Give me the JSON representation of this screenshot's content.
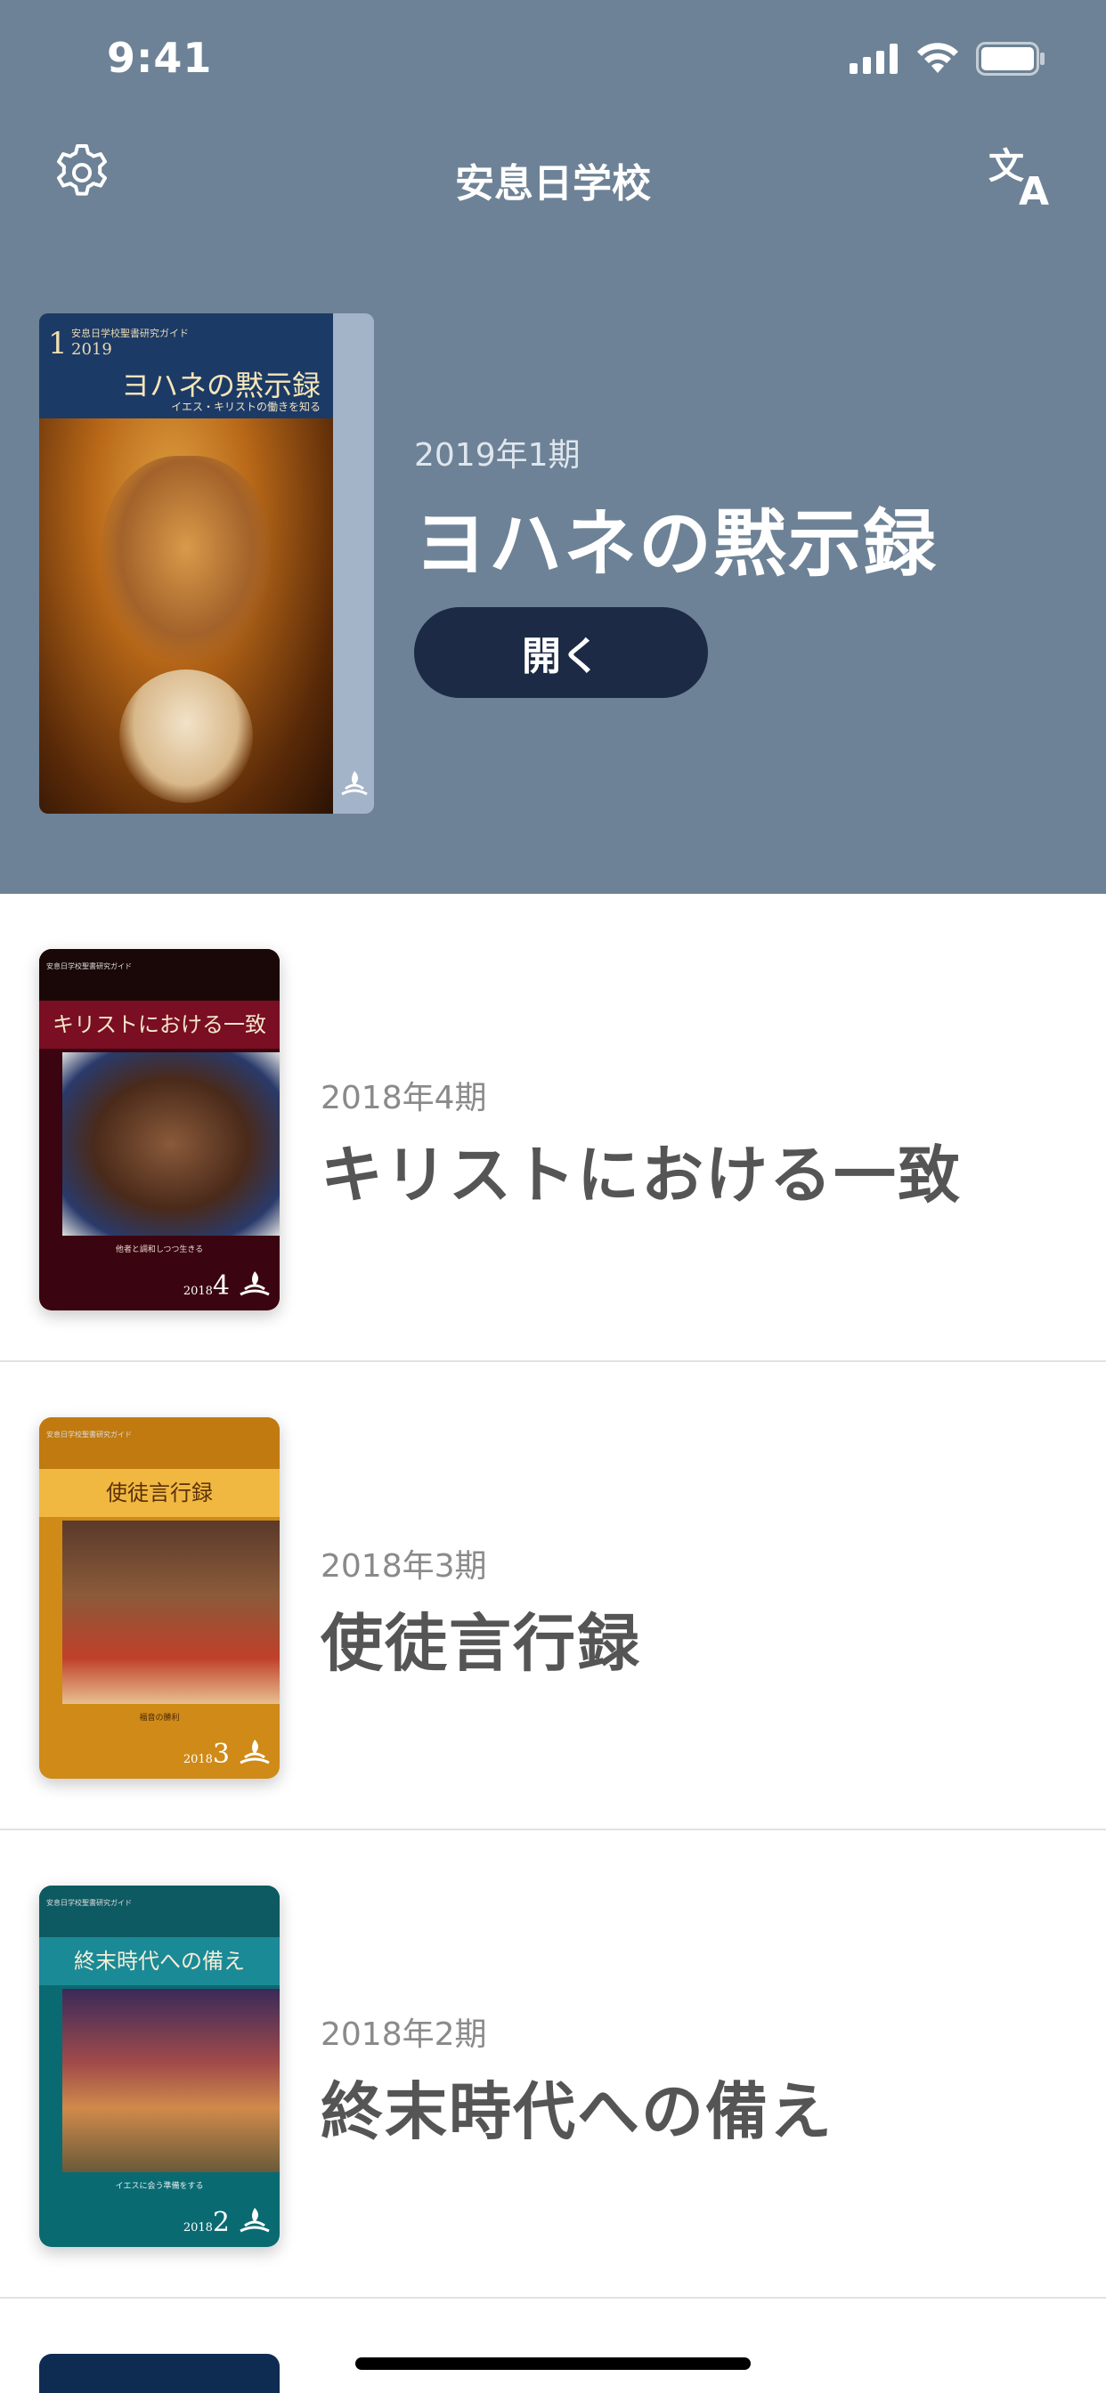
{
  "status": {
    "time": "9:41"
  },
  "header": {
    "title": "安息日学校"
  },
  "featured": {
    "quarter": "2019年1期",
    "title": "ヨハネの黙示録",
    "button_label": "開く",
    "cover": {
      "number": "1",
      "small": "安息日学校聖書研究ガイド",
      "year": "2019",
      "title": "ヨハネの黙示録",
      "subtitle": "イエス・キリストの働きを知る"
    }
  },
  "quarterlies": [
    {
      "quarter": "2018年4期",
      "title": "キリストにおける一致",
      "cover": {
        "small": "安息日学校聖書研究ガイド",
        "title": "キリストにおける一致",
        "caption": "他者と調和しつつ生きる",
        "year": "2018",
        "number": "4",
        "top_color": "#1a0808",
        "band_color": "#7a0e22",
        "bottom_color": "#3a0510"
      }
    },
    {
      "quarter": "2018年3期",
      "title": "使徒言行録",
      "cover": {
        "small": "安息日学校聖書研究ガイド",
        "title": "使徒言行録",
        "caption": "福音の勝利",
        "year": "2018",
        "number": "3",
        "top_color": "#c07a10",
        "band_color": "#f0b840",
        "bottom_color": "#d08a18"
      }
    },
    {
      "quarter": "2018年2期",
      "title": "終末時代への備え",
      "cover": {
        "small": "安息日学校聖書研究ガイド",
        "title": "終末時代への備え",
        "caption": "イエスに会う準備をする",
        "year": "2018",
        "number": "2",
        "top_color": "#0e5a62",
        "band_color": "#1a8a96",
        "bottom_color": "#0a6a72"
      }
    }
  ],
  "icons": {
    "settings": "gear-icon",
    "language": "translate-icon"
  },
  "colors": {
    "header_bg": "#6d8296",
    "button_bg": "#1c2a45"
  }
}
